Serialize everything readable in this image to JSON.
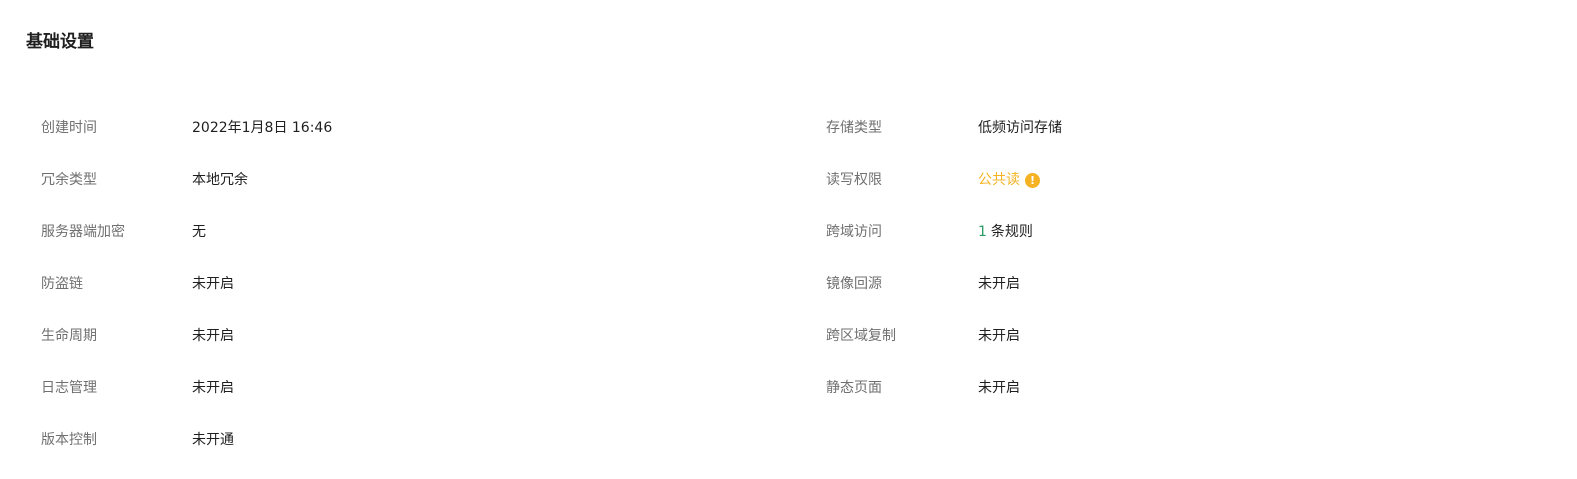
{
  "section": {
    "title": "基础设置"
  },
  "left": [
    {
      "label": "创建时间",
      "value": "2022年1月8日 16:46"
    },
    {
      "label": "冗余类型",
      "value": "本地冗余"
    },
    {
      "label": "服务器端加密",
      "value": "无"
    },
    {
      "label": "防盗链",
      "value": "未开启"
    },
    {
      "label": "生命周期",
      "value": "未开启"
    },
    {
      "label": "日志管理",
      "value": "未开启"
    },
    {
      "label": "版本控制",
      "value": "未开通"
    }
  ],
  "right": [
    {
      "label": "存储类型",
      "value": "低频访问存储"
    },
    {
      "label": "读写权限",
      "value": "公共读",
      "icon": "warning-info-icon",
      "icon_glyph": "!",
      "color": "#f5b323"
    },
    {
      "label": "跨域访问",
      "count": "1",
      "value": "条规则",
      "count_color": "#2a9b62"
    },
    {
      "label": "镜像回源",
      "value": "未开启"
    },
    {
      "label": "跨区域复制",
      "value": "未开启"
    },
    {
      "label": "静态页面",
      "value": "未开启"
    }
  ]
}
